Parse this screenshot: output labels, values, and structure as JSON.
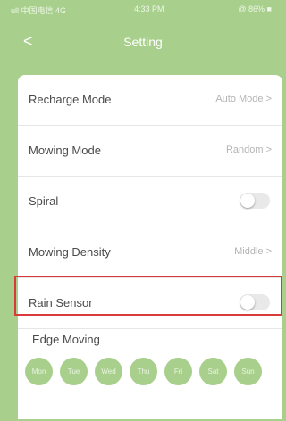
{
  "status_bar": {
    "left": "ull 中国电信 4G",
    "time": "4:33 PM",
    "right": "@ 86% ■"
  },
  "nav": {
    "back": "<",
    "title": "Setting"
  },
  "settings": {
    "rows": [
      {
        "label": "Recharge Mode",
        "value": "Auto Mode >"
      },
      {
        "label": "Mowing Mode",
        "value": "Random >"
      },
      {
        "label": "Spiral",
        "toggle": "off"
      },
      {
        "label": "Mowing Density",
        "value": "Middle >"
      },
      {
        "label": "Rain Sensor",
        "toggle": "off"
      }
    ]
  },
  "edge_moving": {
    "title": "Edge Moving",
    "days": [
      "Mon",
      "Tue",
      "Wed",
      "Thu",
      "Fri",
      "Sat",
      "Sun"
    ]
  },
  "colors": {
    "accent": "#a8d08c",
    "highlight_border": "#d93a3a"
  }
}
